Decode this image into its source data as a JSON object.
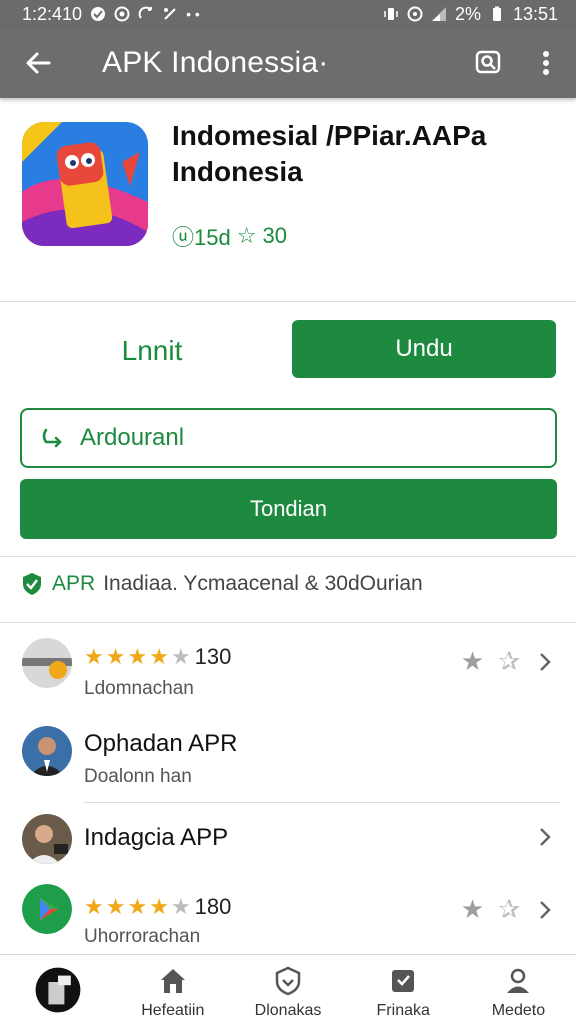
{
  "status_bar": {
    "time_left": "1:2:410",
    "battery_text": "2%",
    "time_right": "13:51"
  },
  "app_bar": {
    "title": "APK Indonessia·"
  },
  "app": {
    "name_line1": "Indomesial /PPiar.AAPa",
    "name_line2": "Indonesia",
    "meta_code": "ⓤ15d",
    "meta_rating": "30"
  },
  "actions": {
    "secondary_label": "Lnnit",
    "primary_label": "Undu",
    "outline_label": "Ardouranl",
    "wide_label": "Tondian"
  },
  "verify": {
    "brand": "APR",
    "text": "Inadiaa. Ycmaacenal & 30dOurian"
  },
  "list": [
    {
      "rating": "130",
      "stars_on": 4,
      "subtitle": "Ldomnachan",
      "has_fav": true
    },
    {
      "title": "Ophadan APR",
      "subtitle": "Doalonn han"
    },
    {
      "title": "Indagcia APP"
    },
    {
      "rating": "180",
      "stars_on": 4,
      "subtitle": "Uhorrorachan",
      "has_fav": true
    }
  ],
  "bottom_nav": [
    {
      "label": ""
    },
    {
      "label": "Hefeatiin"
    },
    {
      "label": "Dlonakas"
    },
    {
      "label": "Frinaka"
    },
    {
      "label": "Medeto"
    }
  ],
  "colors": {
    "accent": "#1e8a3f",
    "appbar": "#6d6d6d",
    "star": "#f0a818"
  }
}
